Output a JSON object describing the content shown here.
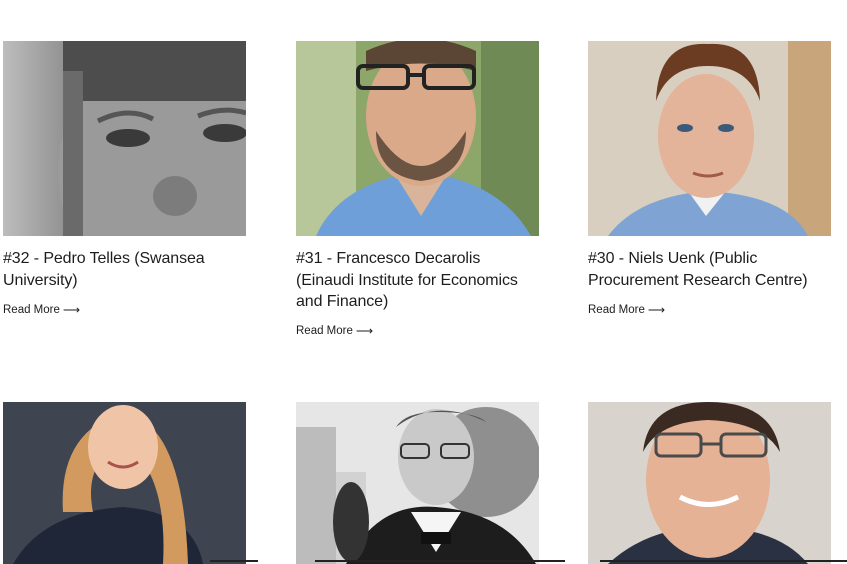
{
  "posts": [
    {
      "title": "#32 - Pedro Telles (Swansea University)",
      "read_more": "Read More",
      "arrow": "⟶"
    },
    {
      "title": "#31 - Francesco Decarolis (Einaudi Institute for Economics and Finance)",
      "read_more": "Read More",
      "arrow": "⟶"
    },
    {
      "title": "#30 - Niels Uenk (Public Procurement Research Centre)",
      "read_more": "Read More",
      "arrow": "⟶"
    }
  ],
  "colors": {
    "text": "#1d1d1f",
    "background": "#ffffff"
  }
}
